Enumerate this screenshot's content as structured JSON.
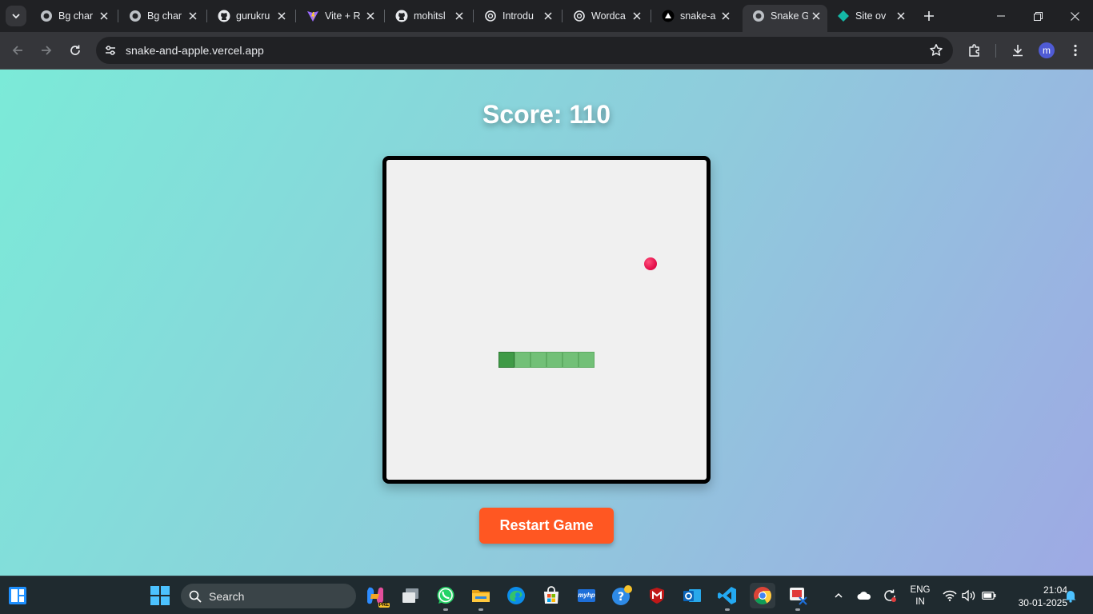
{
  "browser": {
    "tabs": [
      {
        "title": "Bg char",
        "icon": "globe-icon"
      },
      {
        "title": "Bg char",
        "icon": "globe-icon"
      },
      {
        "title": "gurukru",
        "icon": "github-icon"
      },
      {
        "title": "Vite + R",
        "icon": "vite-icon"
      },
      {
        "title": "mohitsl",
        "icon": "github-icon"
      },
      {
        "title": "Introdu",
        "icon": "openai-icon"
      },
      {
        "title": "Wordca",
        "icon": "openai-icon"
      },
      {
        "title": "snake-a",
        "icon": "vercel-icon"
      },
      {
        "title": "Snake G",
        "icon": "globe-icon",
        "active": true
      },
      {
        "title": "Site ov",
        "icon": "netlify-icon"
      }
    ],
    "url": "snake-and-apple.vercel.app",
    "profile_initial": "m"
  },
  "game": {
    "score_text": "Score: 110",
    "restart_label": "Restart Game",
    "board": {
      "cols": 20,
      "rows": 20
    },
    "snake": [
      [
        7,
        12
      ],
      [
        8,
        12
      ],
      [
        9,
        12
      ],
      [
        10,
        12
      ],
      [
        11,
        12
      ],
      [
        12,
        12
      ]
    ],
    "apple": [
      16,
      6
    ],
    "colors": {
      "snake_head": "#3f9a46",
      "snake_body": "#72c077",
      "apple": "#e5114c",
      "button": "#ff5722"
    }
  },
  "taskbar": {
    "search_placeholder": "Search",
    "lang_line1": "ENG",
    "lang_line2": "IN",
    "time": "21:04",
    "date": "30-01-2025",
    "copilot_badge": "PRE",
    "myhp_label": "myhp"
  }
}
